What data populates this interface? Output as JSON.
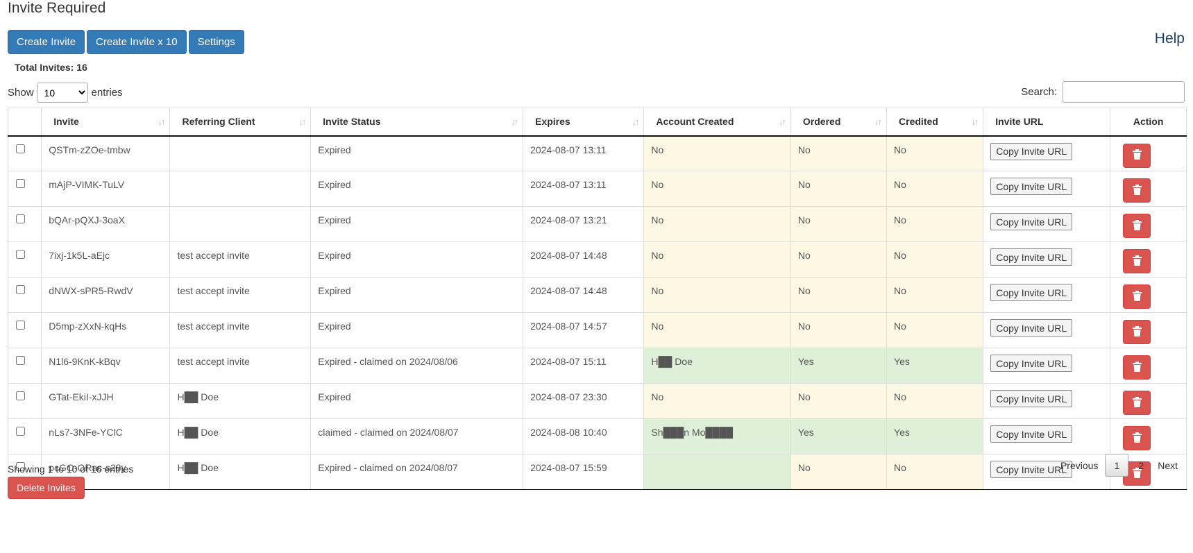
{
  "page": {
    "title": "Invite Required",
    "help": "Help"
  },
  "toolbar": {
    "create": "Create Invite",
    "create10": "Create Invite x 10",
    "settings": "Settings"
  },
  "total": "Total Invites: 16",
  "length": {
    "show": "Show",
    "selected": "10",
    "entries": "entries"
  },
  "search": {
    "label": "Search:",
    "value": ""
  },
  "columns": [
    "Invite",
    "Referring Client",
    "Invite Status",
    "Expires",
    "Account Created",
    "Ordered",
    "Credited",
    "Invite URL",
    "Action"
  ],
  "copy_label": "Copy Invite URL",
  "rows": [
    {
      "invite": "QSTm-zZOe-tmbw",
      "referrer": "",
      "status": "Expired",
      "expires": "2024-08-07 13:11",
      "account": "No",
      "ordered": "No",
      "credited": "No"
    },
    {
      "invite": "mAjP-VIMK-TuLV",
      "referrer": "",
      "status": "Expired",
      "expires": "2024-08-07 13:11",
      "account": "No",
      "ordered": "No",
      "credited": "No"
    },
    {
      "invite": "bQAr-pQXJ-3oaX",
      "referrer": "",
      "status": "Expired",
      "expires": "2024-08-07 13:21",
      "account": "No",
      "ordered": "No",
      "credited": "No"
    },
    {
      "invite": "7ixj-1k5L-aEjc",
      "referrer": "test accept invite",
      "status": "Expired",
      "expires": "2024-08-07 14:48",
      "account": "No",
      "ordered": "No",
      "credited": "No"
    },
    {
      "invite": "dNWX-sPR5-RwdV",
      "referrer": "test accept invite",
      "status": "Expired",
      "expires": "2024-08-07 14:48",
      "account": "No",
      "ordered": "No",
      "credited": "No"
    },
    {
      "invite": "D5mp-zXxN-kqHs",
      "referrer": "test accept invite",
      "status": "Expired",
      "expires": "2024-08-07 14:57",
      "account": "No",
      "ordered": "No",
      "credited": "No"
    },
    {
      "invite": "N1l6-9KnK-kBqv",
      "referrer": "test accept invite",
      "status": "Expired - claimed on 2024/08/06",
      "expires": "2024-08-07 15:11",
      "account": "H██ Doe",
      "ordered": "Yes",
      "credited": "Yes"
    },
    {
      "invite": "GTat-EkiI-xJJH",
      "referrer": "H██ Doe",
      "status": "Expired",
      "expires": "2024-08-07 23:30",
      "account": "No",
      "ordered": "No",
      "credited": "No"
    },
    {
      "invite": "nLs7-3NFe-YClC",
      "referrer": "H██ Doe",
      "status": "claimed - claimed on 2024/08/07",
      "expires": "2024-08-08 10:40",
      "account": "Sh███n Mo████",
      "ordered": "Yes",
      "credited": "Yes"
    },
    {
      "invite": "pcGO-ORac-s28y",
      "referrer": "H██ Doe",
      "status": "Expired - claimed on 2024/08/07",
      "expires": "2024-08-07 15:59",
      "account": "",
      "ordered": "No",
      "credited": "No"
    }
  ],
  "footer": {
    "showing": "Showing 1 to 10 of 16 entries",
    "previous": "Previous",
    "page1": "1",
    "page2": "2",
    "next": "Next",
    "delete": "Delete Invites"
  },
  "colors": {
    "primary": "#337ab7",
    "danger": "#d9534f",
    "warning_bg": "#fcf8e3",
    "success_bg": "#dff0d8"
  }
}
